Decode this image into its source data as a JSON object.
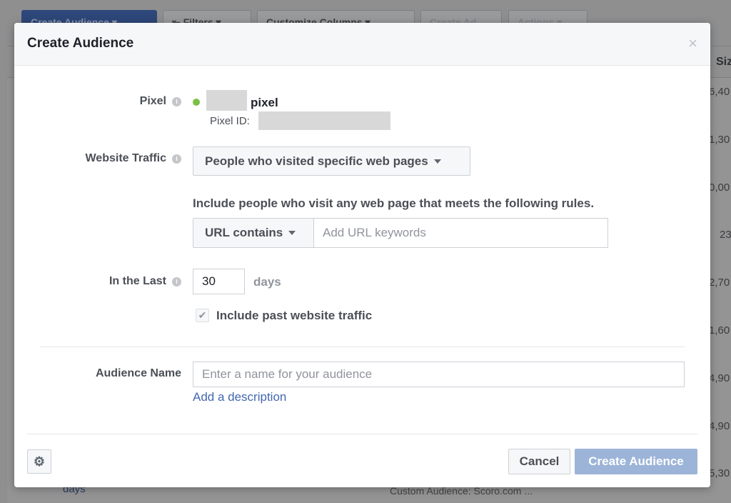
{
  "background": {
    "toolbar": [
      "Create Audience",
      "Filters",
      "Customize Columns",
      "Create Ad",
      "Actions"
    ],
    "size_header": "Siz",
    "size_values": [
      "6,40",
      "1,30",
      "0,00",
      "23",
      "2,70",
      "1,60",
      "4,90",
      "4,90",
      "5,30"
    ],
    "row_text": "days",
    "row_type": "Custom Audience: Scoro.com ..."
  },
  "modal": {
    "title": "Create Audience",
    "close": "×",
    "pixel_label": "Pixel",
    "pixel_name": "pixel",
    "pixel_status_color": "#7ac142",
    "pixel_id_label": "Pixel ID:",
    "traffic_label": "Website Traffic",
    "traffic_value": "People who visited specific web pages",
    "rules_text": "Include people who visit any web page that meets the following rules.",
    "url_rule": "URL contains",
    "url_placeholder": "Add URL keywords",
    "last_label": "In the Last",
    "last_value": "30",
    "last_unit": "days",
    "past_traffic_label": "Include past website traffic",
    "past_traffic_checked": true,
    "name_label": "Audience Name",
    "name_placeholder": "Enter a name for your audience",
    "add_description": "Add a description",
    "cancel": "Cancel",
    "create": "Create Audience",
    "accent": "#4267b2"
  }
}
